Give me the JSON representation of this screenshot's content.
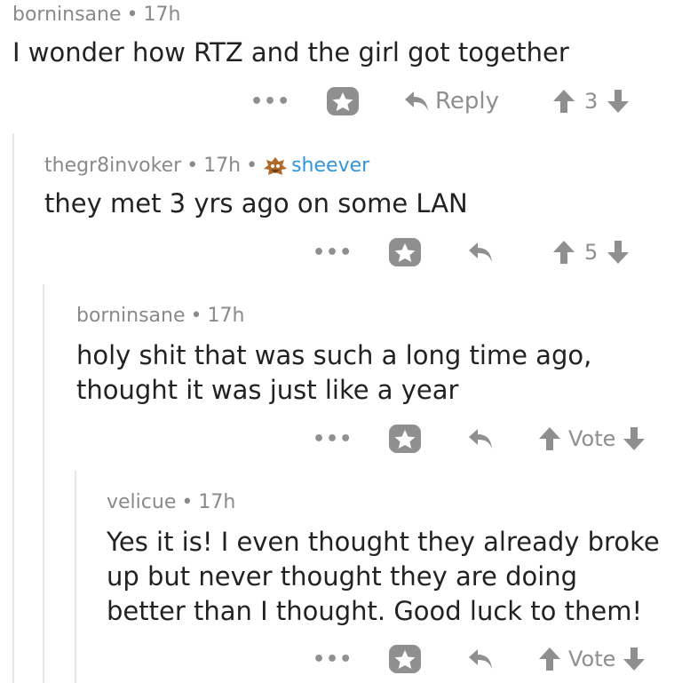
{
  "comments": [
    {
      "author": "borninsane",
      "time": "17h",
      "body_lines": [
        "I wonder how RTZ and the girl got together"
      ],
      "reply_label": "Reply",
      "score": "3"
    },
    {
      "author": "thegr8invoker",
      "time": "17h",
      "flair": "sheever",
      "body_lines": [
        "they met 3 yrs ago on some LAN"
      ],
      "score": "5"
    },
    {
      "author": "borninsane",
      "time": "17h",
      "body_lines": [
        "holy shit that was such a long time ago,",
        "thought it was just like a year"
      ],
      "vote_label": "Vote"
    },
    {
      "author": "velicue",
      "time": "17h",
      "body_lines": [
        "Yes it is! I even thought they already broke",
        "up but never thought they are doing",
        "better than I thought. Good luck to them!"
      ],
      "vote_label": "Vote"
    }
  ],
  "ui": {
    "dot_separator": "•",
    "more_dots": "•••"
  },
  "colors": {
    "meta_gray": "#8a8a8a",
    "icon_gray": "#8f8f8f",
    "flair_blue": "#3394dc",
    "thread_line": "#e6e6e6"
  }
}
